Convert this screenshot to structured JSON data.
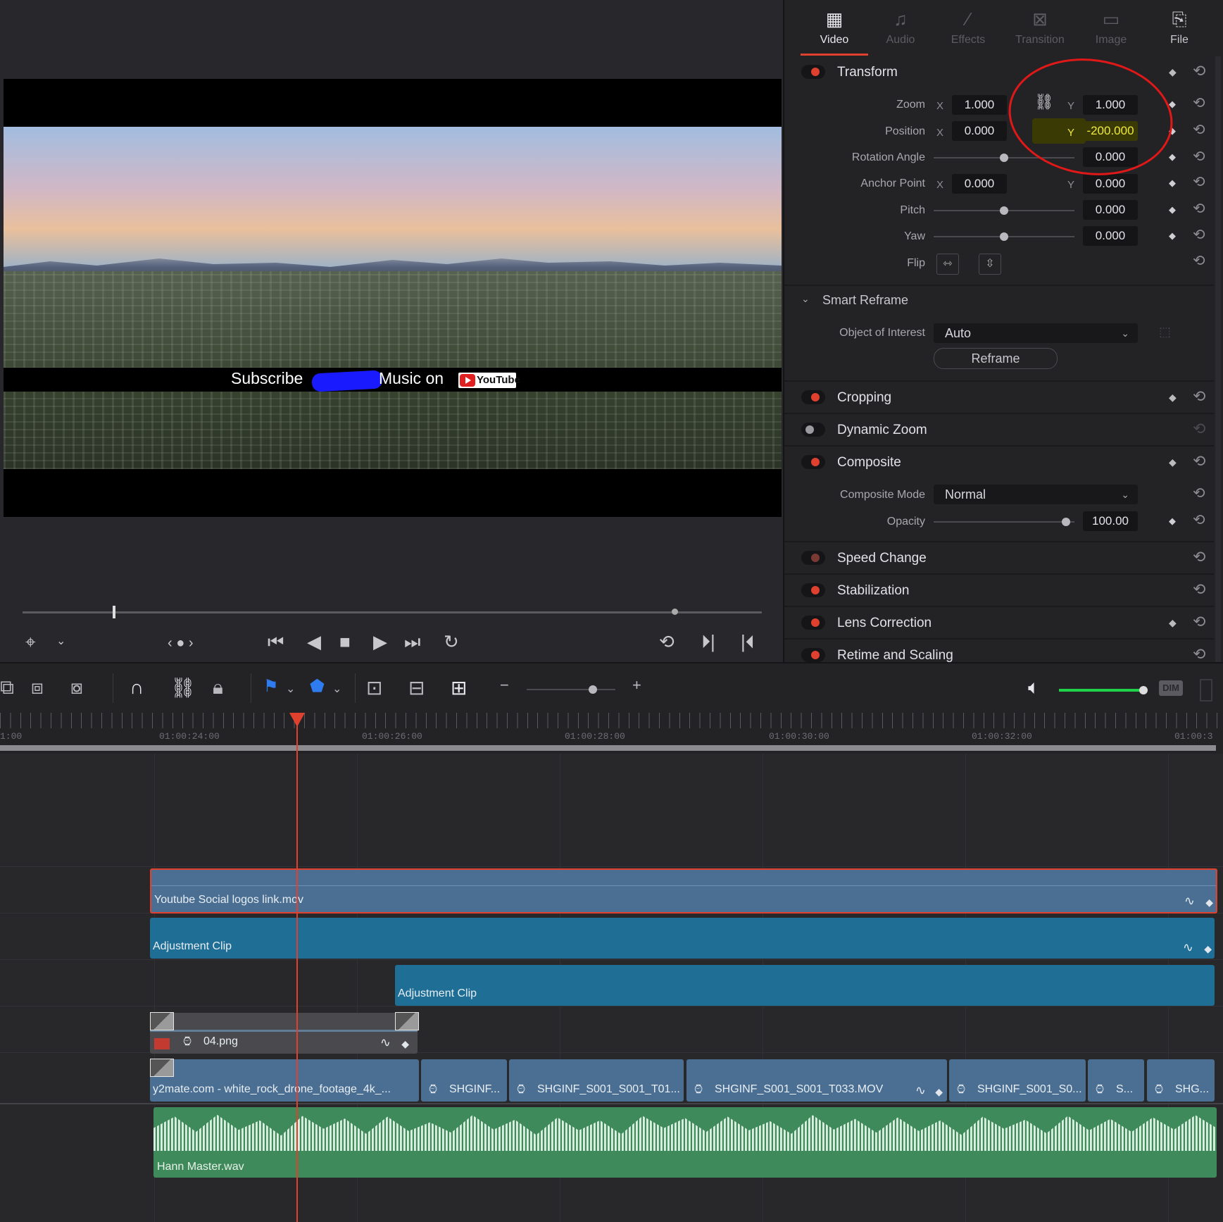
{
  "preview": {
    "banner_left": "Subscribe",
    "banner_right": "Music on",
    "youtube_logo": "YouTube"
  },
  "inspector": {
    "tabs": [
      {
        "label": "Video",
        "icon": "film-icon",
        "active": true
      },
      {
        "label": "Audio",
        "icon": "music-note-icon",
        "active": false
      },
      {
        "label": "Effects",
        "icon": "magic-wand-icon",
        "active": false
      },
      {
        "label": "Transition",
        "icon": "transition-icon",
        "active": false
      },
      {
        "label": "Image",
        "icon": "image-icon",
        "active": false
      },
      {
        "label": "File",
        "icon": "file-icon",
        "active": false
      }
    ],
    "transform": {
      "title": "Transform",
      "zoom_label": "Zoom",
      "zoom_x": "1.000",
      "zoom_y": "1.000",
      "position_label": "Position",
      "position_x": "0.000",
      "position_y": "-200.000",
      "rotation_label": "Rotation Angle",
      "rotation": "0.000",
      "anchor_label": "Anchor Point",
      "anchor_x": "0.000",
      "anchor_y": "0.000",
      "pitch_label": "Pitch",
      "pitch": "0.000",
      "yaw_label": "Yaw",
      "yaw": "0.000",
      "flip_label": "Flip",
      "x_axis": "X",
      "y_axis": "Y"
    },
    "smart_reframe": {
      "title": "Smart Reframe",
      "object_label": "Object of Interest",
      "object_value": "Auto",
      "reframe_button": "Reframe"
    },
    "cropping": {
      "title": "Cropping"
    },
    "dynamic_zoom": {
      "title": "Dynamic Zoom"
    },
    "composite": {
      "title": "Composite",
      "mode_label": "Composite Mode",
      "mode_value": "Normal",
      "opacity_label": "Opacity",
      "opacity_value": "100.00"
    },
    "speed_change": {
      "title": "Speed Change"
    },
    "stabilization": {
      "title": "Stabilization"
    },
    "lens_correction": {
      "title": "Lens Correction"
    },
    "retime": {
      "title": "Retime and Scaling"
    }
  },
  "toolbar": {
    "dim_label": "DIM"
  },
  "ruler": {
    "timecodes": [
      "1:00",
      "01:00:24:00",
      "01:00:26:00",
      "01:00:28:00",
      "01:00:30:00",
      "01:00:32:00",
      "01:00:3"
    ]
  },
  "timeline": {
    "clips": {
      "youtube": "Youtube Social logos link.mov",
      "adj1": "Adjustment Clip",
      "adj2": "Adjustment Clip",
      "png": "04.png",
      "y2mate": "y2mate.com - white_rock_drone_footage_4k_...",
      "sh1": "SHGINF...",
      "sh2": "SHGINF_S001_S001_T01...",
      "sh3": "SHGINF_S001_S001_T033.MOV",
      "sh4": "SHGINF_S001_S0...",
      "sh5": "S...",
      "sh6": "SHG...",
      "audio": "Hann Master.wav"
    }
  },
  "colors": {
    "accent_red": "#e0412f",
    "clip_blue": "#4a6f93",
    "adjustment_blue": "#1e6e95",
    "audio_green": "#3e8a5a",
    "highlight_yellow": "#f0e93a"
  }
}
